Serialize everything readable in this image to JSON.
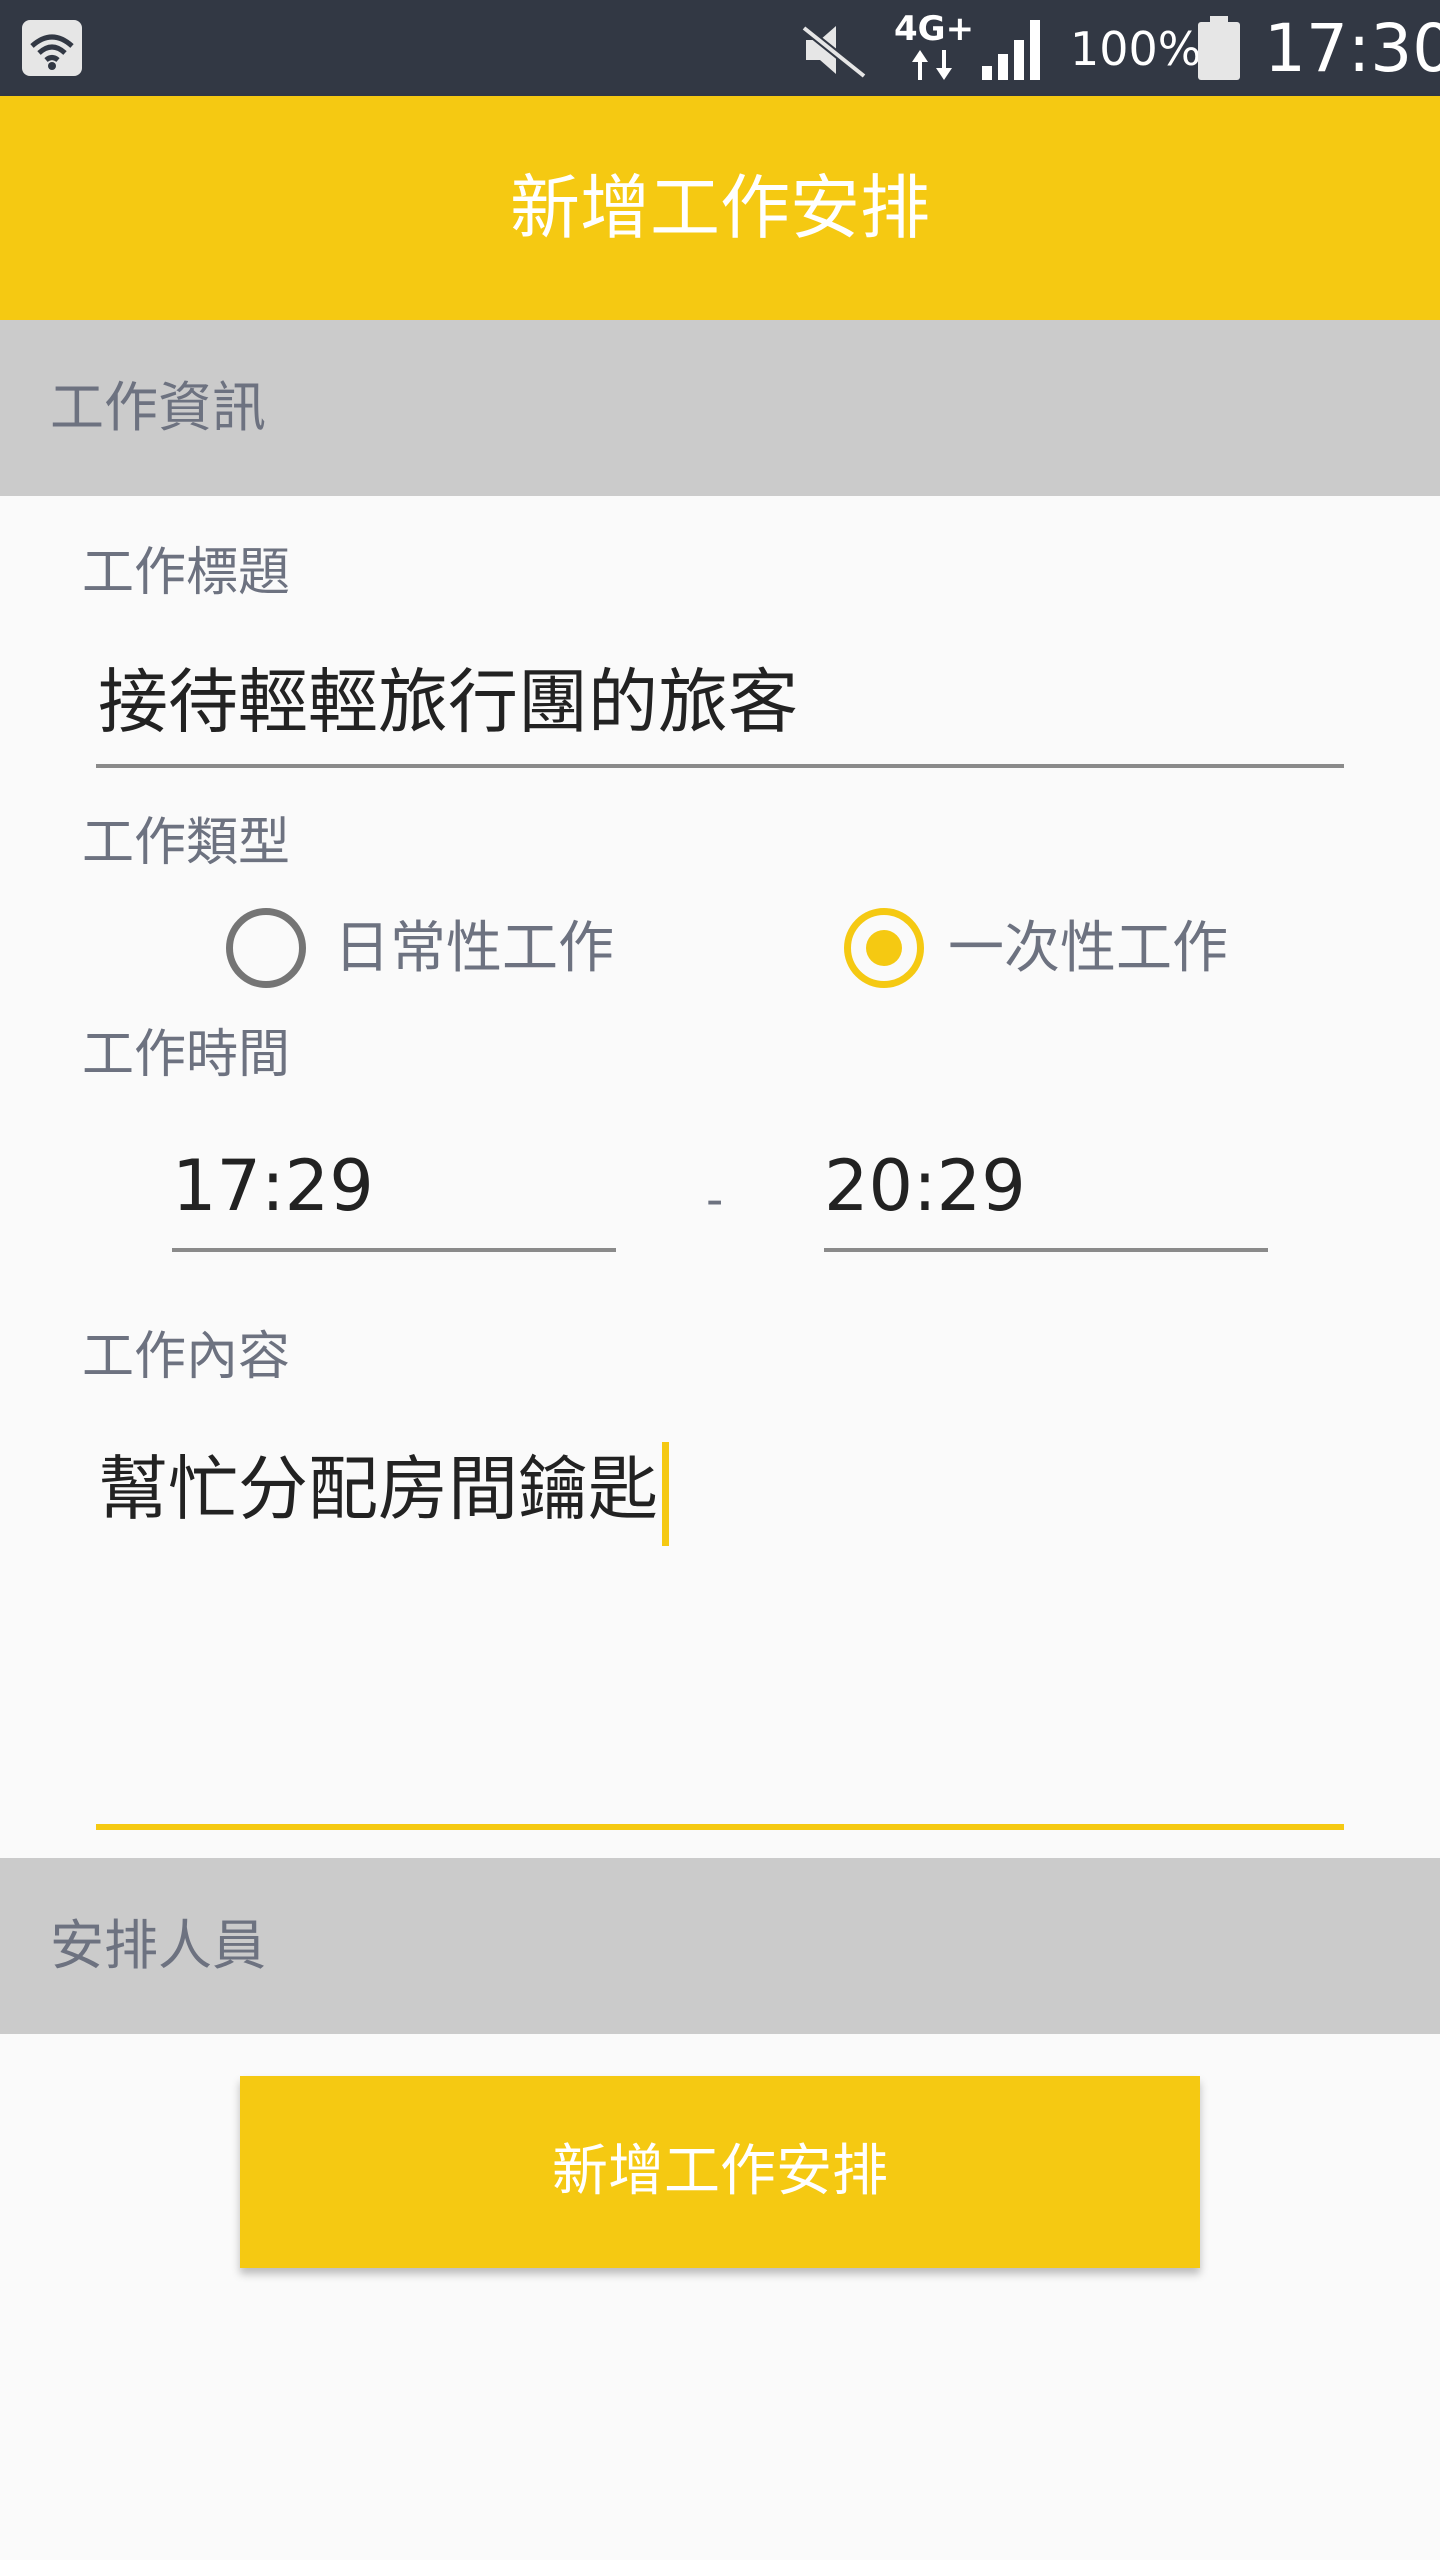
{
  "status_bar": {
    "network": "4G+",
    "battery_percent": "100%",
    "time": "17:30",
    "icons": [
      "wifi-icon",
      "mute-icon",
      "signal-icon",
      "battery-icon"
    ]
  },
  "app_bar": {
    "title": "新增工作安排"
  },
  "sections": {
    "job_info": "工作資訊",
    "assign_staff": "安排人員"
  },
  "form": {
    "title_label": "工作標題",
    "title_value": "接待輕輕旅行團的旅客",
    "type_label": "工作類型",
    "type_options": [
      {
        "label": "日常性工作",
        "selected": false
      },
      {
        "label": "一次性工作",
        "selected": true
      }
    ],
    "time_label": "工作時間",
    "time_start": "17:29",
    "time_separator": "-",
    "time_end": "20:29",
    "content_label": "工作內容",
    "content_value": "幫忙分配房間鑰匙"
  },
  "submit_button": {
    "label": "新增工作安排"
  },
  "colors": {
    "accent": "#f5c912",
    "status_bar": "#323844",
    "section_header": "#cbcbcb",
    "label_text": "#6d7280"
  }
}
